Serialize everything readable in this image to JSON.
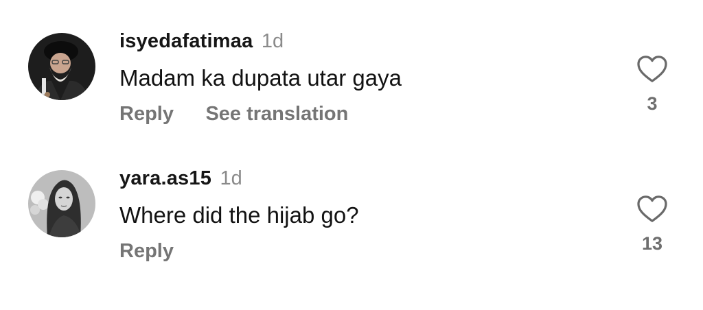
{
  "comments": [
    {
      "username": "isyedafatimaa",
      "time": "1d",
      "text": "Madam ka dupata utar gaya",
      "actions": [
        "Reply",
        "See translation"
      ],
      "likes": "3",
      "avatar_icon": "elderly-man-avatar"
    },
    {
      "username": "yara.as15",
      "time": "1d",
      "text": "Where did the hijab go?",
      "actions": [
        "Reply"
      ],
      "likes": "13",
      "avatar_icon": "woman-portrait-avatar"
    }
  ],
  "colors": {
    "text": "#121212",
    "muted": "#8a8a8a",
    "action": "#757575",
    "background": "#ffffff"
  }
}
